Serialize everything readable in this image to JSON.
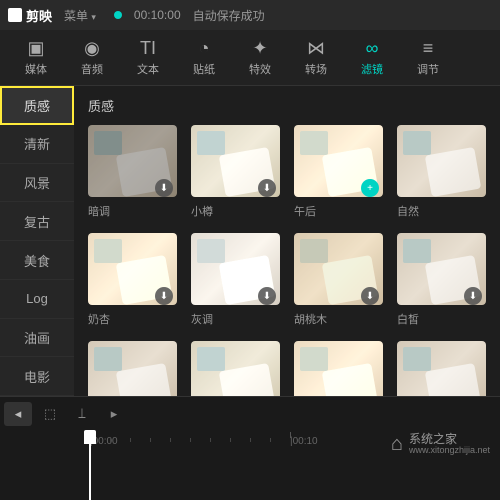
{
  "titlebar": {
    "app_name": "剪映",
    "menu_label": "菜单",
    "save_time": "00:10:00",
    "save_status": "自动保存成功"
  },
  "toolbar": [
    {
      "label": "媒体",
      "icon": "▣"
    },
    {
      "label": "音频",
      "icon": "◉"
    },
    {
      "label": "文本",
      "icon": "TI"
    },
    {
      "label": "贴纸",
      "icon": "◔"
    },
    {
      "label": "特效",
      "icon": "✦"
    },
    {
      "label": "转场",
      "icon": "⋈"
    },
    {
      "label": "滤镜",
      "icon": "∞",
      "active": true
    },
    {
      "label": "调节",
      "icon": "≡"
    }
  ],
  "sidebar": [
    {
      "label": "质感",
      "highlighted": true
    },
    {
      "label": "清新"
    },
    {
      "label": "风景"
    },
    {
      "label": "复古"
    },
    {
      "label": "美食"
    },
    {
      "label": "Log"
    },
    {
      "label": "油画"
    },
    {
      "label": "电影"
    }
  ],
  "content": {
    "title": "质感",
    "filters": [
      {
        "label": "暗调",
        "variant": "dark",
        "badge": "download"
      },
      {
        "label": "小樽",
        "variant": "cool",
        "badge": "download"
      },
      {
        "label": "午后",
        "variant": "warm",
        "badge": "add"
      },
      {
        "label": "自然",
        "variant": "",
        "badge": ""
      },
      {
        "label": "奶杏",
        "variant": "warm",
        "badge": "download"
      },
      {
        "label": "灰调",
        "variant": "gray",
        "badge": "download"
      },
      {
        "label": "胡桃木",
        "variant": "walnut",
        "badge": "download"
      },
      {
        "label": "白皙",
        "variant": "",
        "badge": "download"
      },
      {
        "label": "",
        "variant": "",
        "badge": ""
      },
      {
        "label": "",
        "variant": "cool",
        "badge": ""
      },
      {
        "label": "",
        "variant": "warm",
        "badge": ""
      },
      {
        "label": "",
        "variant": "",
        "badge": ""
      }
    ]
  },
  "timeline_tools": {
    "back": "◂",
    "cursor": "⬚",
    "cut": "⟘",
    "forward": "▸"
  },
  "timeline": {
    "ticks": [
      {
        "label": "|00:00",
        "pos": 0
      },
      {
        "label": "|00:10",
        "pos": 200
      }
    ]
  },
  "watermark": {
    "name": "系统之家",
    "url": "www.xitongzhijia.net"
  }
}
